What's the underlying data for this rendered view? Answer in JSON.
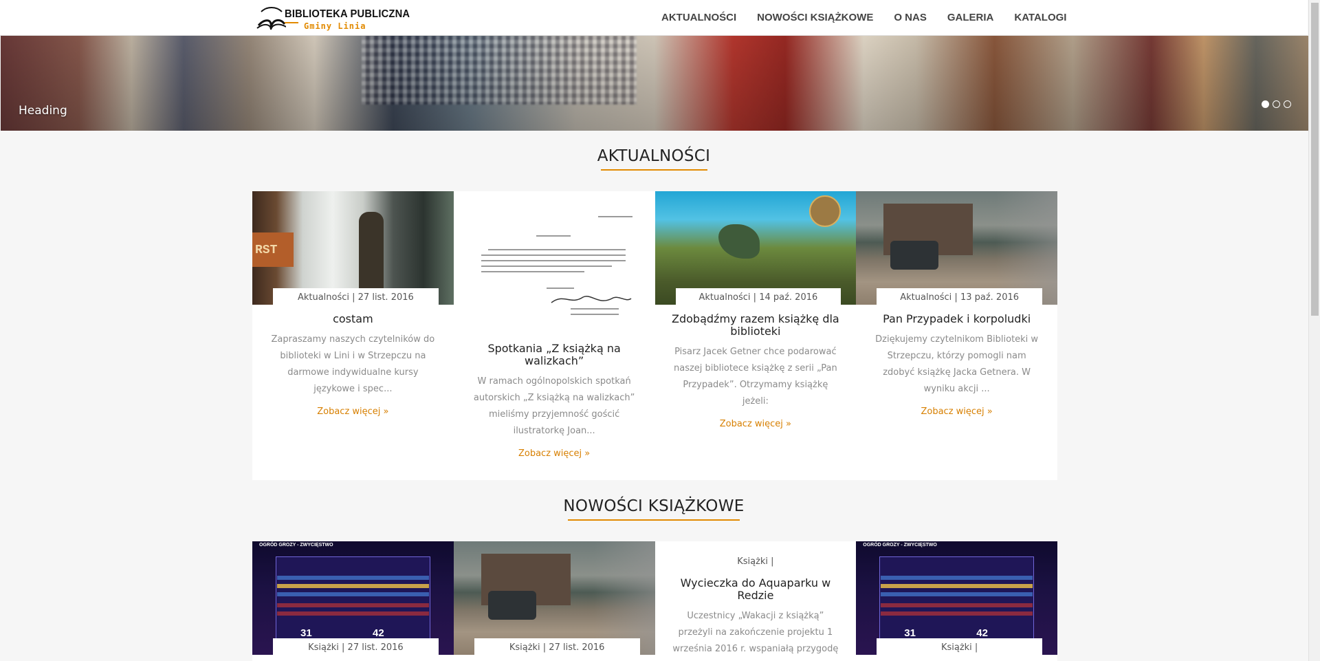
{
  "brand": {
    "title": "BIBLIOTEKA PUBLICZNA",
    "subtitle": "Gminy Linia"
  },
  "nav": [
    "AKTUALNOŚCI",
    "NOWOŚCI KSIĄŻKOWE",
    "O NAS",
    "GALERIA",
    "KATALOGI"
  ],
  "hero": {
    "heading": "Heading",
    "slides": 3,
    "active_slide": 1
  },
  "news": {
    "title": "AKTUALNOŚCI",
    "cards": [
      {
        "meta": "Aktualności | 27 list. 2016",
        "title": "costam",
        "excerpt": "Zapraszamy naszych czytelników do biblioteki w Lini i w Strzepczu na darmowe indywidualne kursy językowe i spec...",
        "more": "Zobacz więcej »"
      },
      {
        "meta": "Aktualności | 27 list. 2016",
        "title": "Spotkania „Z książką na walizkach”",
        "excerpt": "W ramach ogólnopolskich spotkań autorskich „Z książką na walizkach” mieliśmy przyjemność gościć ilustratorkę Joan...",
        "more": "Zobacz więcej »"
      },
      {
        "meta": "Aktualności | 14 paź. 2016",
        "title": "Zdobądźmy razem książkę dla biblioteki",
        "excerpt": "Pisarz Jacek Getner chce podarować naszej bibliotece książkę z serii „Pan Przypadek”. Otrzymamy książkę jeżeli:",
        "more": "Zobacz więcej »"
      },
      {
        "meta": "Aktualności | 13 paź. 2016",
        "title": "Pan Przypadek i korpoludki",
        "excerpt": "Dziękujemy czytelnikom Biblioteki w Strzepczu, którzy pomogli nam zdobyć książkę Jacka Getnera. W wyniku akcji ...",
        "more": "Zobacz więcej »"
      }
    ]
  },
  "books": {
    "title": "NOWOŚCI KSIĄŻKOWE",
    "cards": [
      {
        "meta": "Książki | 27 list. 2016",
        "game_title": "OGRÓD GROZY - ZWYCIĘSTWO",
        "score_left": "31",
        "score_right": "42"
      },
      {
        "meta": "Książki | 27 list. 2016"
      },
      {
        "meta": "Książki |",
        "title": "Wycieczka do Aquaparku w Redzie",
        "excerpt": "Uczestnicy „Wakacji z książką” przeżyli na zakończenie projektu 1 września 2016 r. wspaniałą przygodę w Aquapar..."
      },
      {
        "meta": "Książki |",
        "game_title": "OGRÓD GROZY - ZWYCIĘSTWO",
        "score_left": "31",
        "score_right": "42"
      }
    ]
  },
  "colors": {
    "accent": "#e28a00",
    "link": "#d77f00",
    "background": "#f6f6f6"
  }
}
